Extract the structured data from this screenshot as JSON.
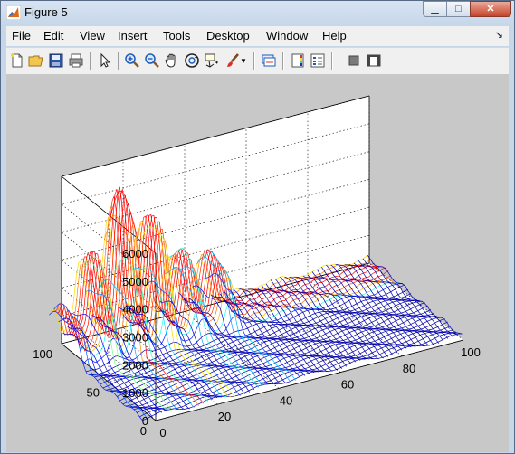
{
  "window": {
    "title": "Figure 5"
  },
  "menu": {
    "items": [
      "File",
      "Edit",
      "View",
      "Insert",
      "Tools",
      "Desktop",
      "Window",
      "Help"
    ],
    "dock_arrow": "↘"
  },
  "toolbar": {
    "icons": [
      "new-figure-icon",
      "open-file-icon",
      "save-figure-icon",
      "print-figure-icon",
      "edit-plot-arrow-icon",
      "zoom-in-icon",
      "zoom-out-icon",
      "pan-hand-icon",
      "rotate-3d-icon",
      "data-cursor-icon",
      "brush-icon",
      "brush-dropdown-icon",
      "link-plot-icon",
      "insert-colorbar-icon",
      "insert-legend-icon",
      "hide-plot-tools-icon",
      "show-plot-tools-icon"
    ]
  },
  "chart_data": {
    "type": "surface-3d-mesh",
    "title": "",
    "xlabel": "",
    "ylabel": "",
    "zlabel": "",
    "x_ticks": [
      "0",
      "20",
      "40",
      "60",
      "80",
      "100"
    ],
    "y_ticks": [
      "0",
      "50",
      "100"
    ],
    "z_ticks": [
      "0",
      "1000",
      "2000",
      "3000",
      "4000",
      "5000",
      "6000"
    ],
    "xlim": [
      0,
      100
    ],
    "ylim": [
      0,
      100
    ],
    "zlim": [
      0,
      6000
    ],
    "grid": true,
    "colormap": [
      "#00008f",
      "#0000ff",
      "#00ffff",
      "#ffff00",
      "#ff0000"
    ],
    "surface": {
      "baseline": 300,
      "data_starts_at_y": 60,
      "peaks": [
        {
          "x": 15,
          "y": 80,
          "z": 5100
        },
        {
          "x": 25,
          "y": 80,
          "z": 4100
        },
        {
          "x": 6,
          "y": 80,
          "z": 3100
        },
        {
          "x": 35,
          "y": 80,
          "z": 2500
        },
        {
          "x": 45,
          "y": 80,
          "z": 2100
        },
        {
          "x": -3,
          "y": 80,
          "z": 1300
        }
      ]
    }
  }
}
